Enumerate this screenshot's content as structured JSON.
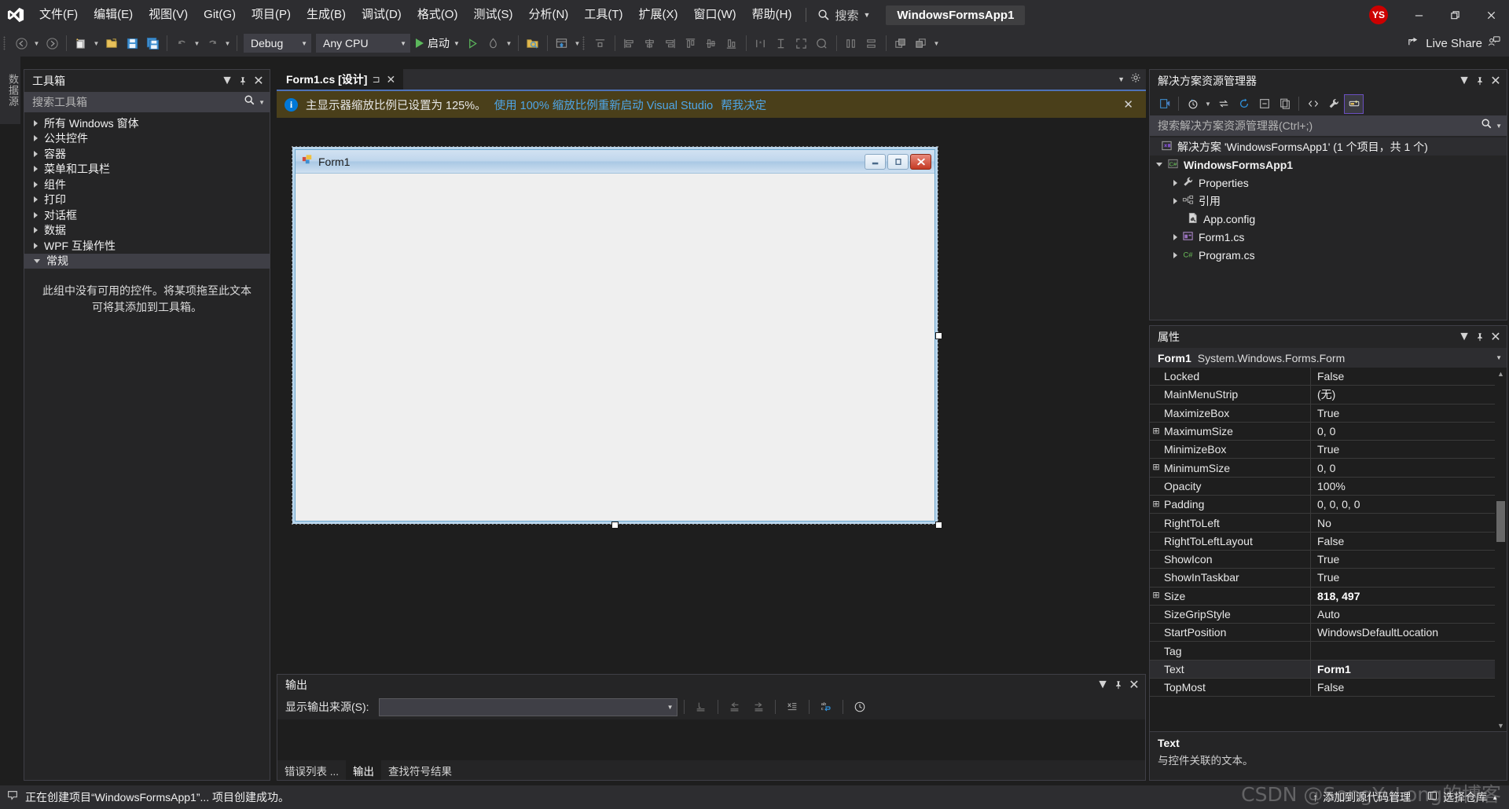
{
  "titlebar": {
    "menus": [
      "文件(F)",
      "编辑(E)",
      "视图(V)",
      "Git(G)",
      "项目(P)",
      "生成(B)",
      "调试(D)",
      "格式(O)",
      "测试(S)",
      "分析(N)",
      "工具(T)",
      "扩展(X)",
      "窗口(W)",
      "帮助(H)"
    ],
    "search_label": "搜索",
    "project_chip": "WindowsFormsApp1",
    "avatar_initials": "YS",
    "minimize": "—",
    "restore": "❐",
    "close": "✕",
    "accent_blue": "#4e72b8",
    "avatar_color": "#cc0000"
  },
  "toolbar": {
    "config": "Debug",
    "platform": "Any CPU",
    "run_label": "启动",
    "live_share": "Live Share"
  },
  "vertical_tabs": [
    {
      "label": "数据源"
    }
  ],
  "toolbox": {
    "title": "工具箱",
    "search_placeholder": "搜索工具箱",
    "items": [
      {
        "label": "所有 Windows 窗体",
        "expanded": false
      },
      {
        "label": "公共控件",
        "expanded": false
      },
      {
        "label": "容器",
        "expanded": false
      },
      {
        "label": "菜单和工具栏",
        "expanded": false
      },
      {
        "label": "组件",
        "expanded": false
      },
      {
        "label": "打印",
        "expanded": false
      },
      {
        "label": "对话框",
        "expanded": false
      },
      {
        "label": "数据",
        "expanded": false
      },
      {
        "label": "WPF 互操作性",
        "expanded": false
      },
      {
        "label": "常规",
        "expanded": true,
        "selected": true
      }
    ],
    "empty_text": "此组中没有可用的控件。将某项拖至此文本可将其添加到工具箱。"
  },
  "document": {
    "tab_label": "Form1.cs [设计]",
    "pin_glyph": "⊐",
    "close_glyph": "✕"
  },
  "notification": {
    "icon": "i",
    "message": "主显示器缩放比例已设置为 125%。",
    "link_restart": "使用 100% 缩放比例重新启动 Visual Studio",
    "link_decide": "帮我决定",
    "close": "✕",
    "background": "#4a3f1a"
  },
  "form_designer": {
    "form_title": "Form1",
    "minimize_glyph": "—",
    "maximize_glyph": "❐",
    "close_glyph": "✕"
  },
  "output": {
    "title": "输出",
    "source_label": "显示输出来源(S):",
    "source_value": "",
    "tabs": [
      {
        "label": "错误列表 ...",
        "active": false
      },
      {
        "label": "输出",
        "active": true
      },
      {
        "label": "查找符号结果",
        "active": false
      }
    ]
  },
  "solution_explorer": {
    "title": "解决方案资源管理器",
    "search_placeholder": "搜索解决方案资源管理器(Ctrl+;)",
    "tree": [
      {
        "label": "解决方案 'WindowsFormsApp1' (1 个项目，共 1 个)",
        "indent": 0,
        "icon": "solution-icon",
        "arrow": "none",
        "bold": false,
        "selected": true
      },
      {
        "label": "WindowsFormsApp1",
        "indent": 1,
        "icon": "csharp-project-icon",
        "arrow": "down",
        "bold": true,
        "selected": false
      },
      {
        "label": "Properties",
        "indent": 2,
        "icon": "wrench-icon",
        "arrow": "right",
        "bold": false,
        "selected": false
      },
      {
        "label": "引用",
        "indent": 2,
        "icon": "references-icon",
        "arrow": "right",
        "bold": false,
        "selected": false
      },
      {
        "label": "App.config",
        "indent": 2,
        "icon": "config-file-icon",
        "arrow": "none",
        "bold": false,
        "selected": false
      },
      {
        "label": "Form1.cs",
        "indent": 2,
        "icon": "form-file-icon",
        "arrow": "right",
        "bold": false,
        "selected": false
      },
      {
        "label": "Program.cs",
        "indent": 2,
        "icon": "csharp-file-icon",
        "arrow": "right",
        "bold": false,
        "selected": false
      }
    ]
  },
  "properties": {
    "title": "属性",
    "object_name": "Form1",
    "object_type": "System.Windows.Forms.Form",
    "rows": [
      {
        "key": "Locked",
        "value": "False",
        "expandable": false,
        "selected": false
      },
      {
        "key": "MainMenuStrip",
        "value": "(无)",
        "expandable": false,
        "selected": false
      },
      {
        "key": "MaximizeBox",
        "value": "True",
        "expandable": false,
        "selected": false
      },
      {
        "key": "MaximumSize",
        "value": "0, 0",
        "expandable": true,
        "selected": false
      },
      {
        "key": "MinimizeBox",
        "value": "True",
        "expandable": false,
        "selected": false
      },
      {
        "key": "MinimumSize",
        "value": "0, 0",
        "expandable": true,
        "selected": false
      },
      {
        "key": "Opacity",
        "value": "100%",
        "expandable": false,
        "selected": false
      },
      {
        "key": "Padding",
        "value": "0, 0, 0, 0",
        "expandable": true,
        "selected": false
      },
      {
        "key": "RightToLeft",
        "value": "No",
        "expandable": false,
        "selected": false
      },
      {
        "key": "RightToLeftLayout",
        "value": "False",
        "expandable": false,
        "selected": false
      },
      {
        "key": "ShowIcon",
        "value": "True",
        "expandable": false,
        "selected": false
      },
      {
        "key": "ShowInTaskbar",
        "value": "True",
        "expandable": false,
        "selected": false
      },
      {
        "key": "Size",
        "value": "818, 497",
        "expandable": true,
        "selected": false,
        "bold": true
      },
      {
        "key": "SizeGripStyle",
        "value": "Auto",
        "expandable": false,
        "selected": false
      },
      {
        "key": "StartPosition",
        "value": "WindowsDefaultLocation",
        "expandable": false,
        "selected": false
      },
      {
        "key": "Tag",
        "value": "",
        "expandable": false,
        "selected": false
      },
      {
        "key": "Text",
        "value": "Form1",
        "expandable": false,
        "selected": true,
        "bold": true
      },
      {
        "key": "TopMost",
        "value": "False",
        "expandable": false,
        "selected": false
      }
    ],
    "desc_title": "Text",
    "desc_text": "与控件关联的文本。"
  },
  "status_bar": {
    "message": "正在创建项目“WindowsFormsApp1”... 项目创建成功。",
    "add_to_source_control": "添加到源代码管理",
    "select_repository": "选择仓库",
    "up_arrow": "↑"
  },
  "watermark": "CSDN @SongYuLong的博客"
}
